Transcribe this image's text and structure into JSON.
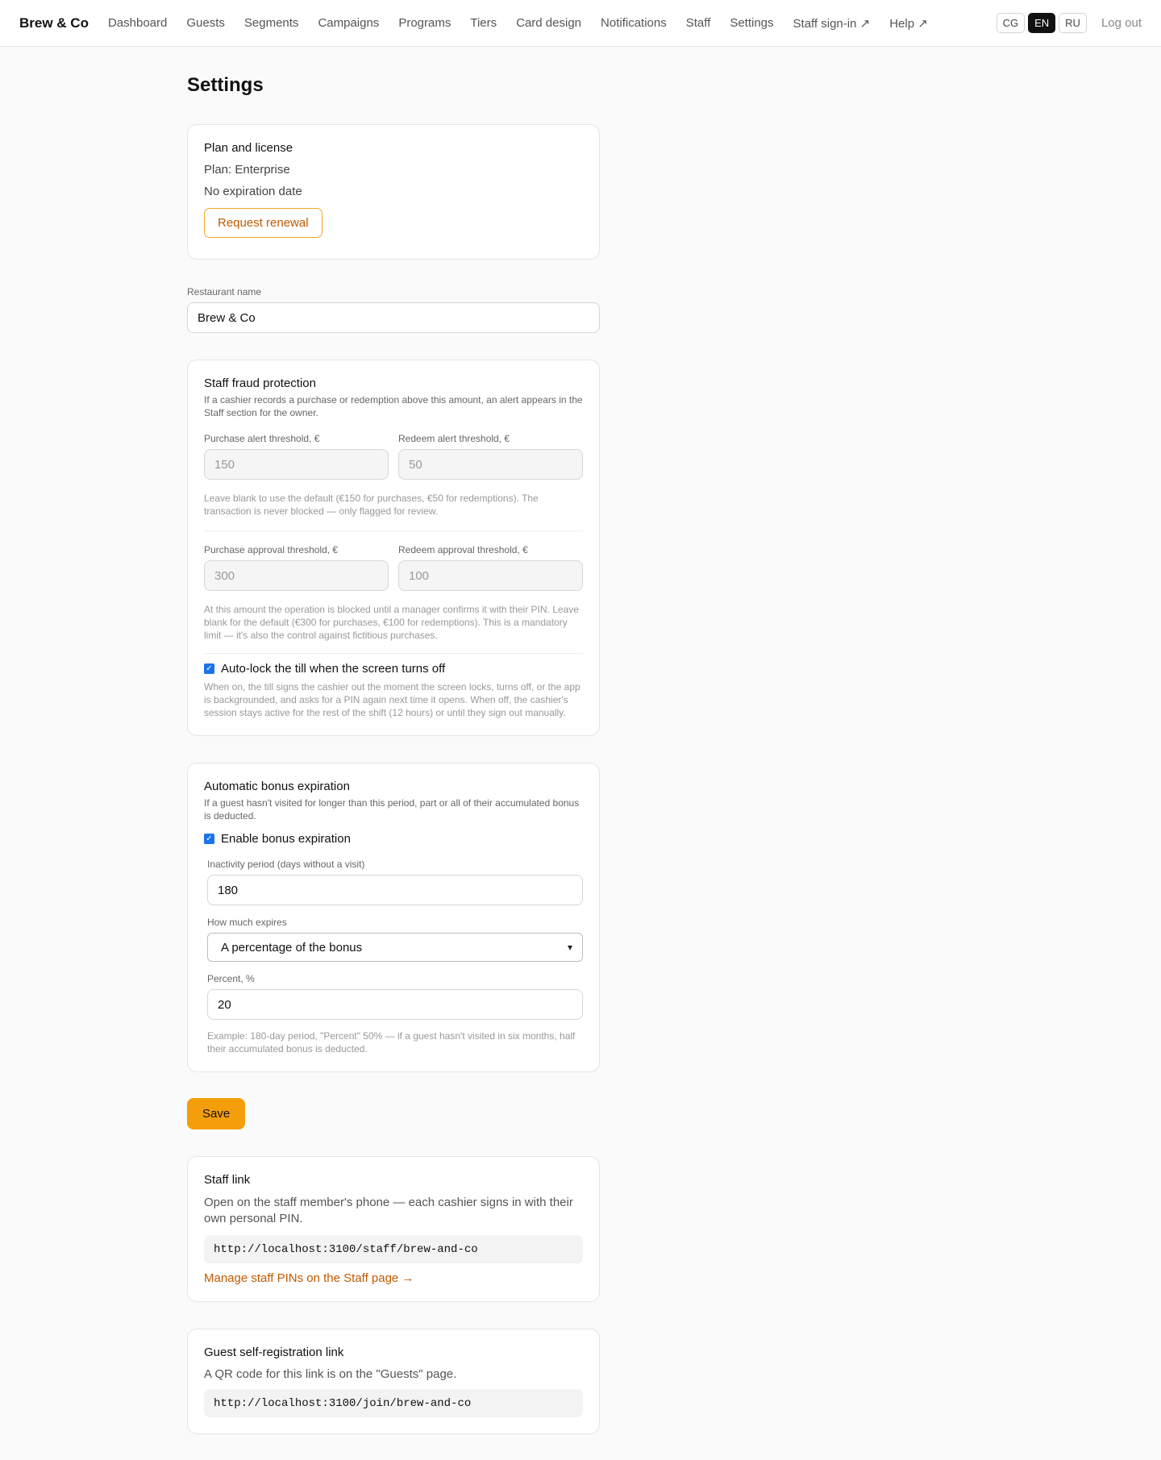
{
  "nav": {
    "brand": "Brew & Co",
    "links": [
      "Dashboard",
      "Guests",
      "Segments",
      "Campaigns",
      "Programs",
      "Tiers",
      "Card design",
      "Notifications",
      "Staff",
      "Settings",
      "Staff sign-in ↗",
      "Help ↗"
    ],
    "languages": [
      "CG",
      "EN",
      "RU"
    ],
    "active_language": "EN",
    "logout": "Log out"
  },
  "page": {
    "title": "Settings"
  },
  "plan": {
    "title": "Plan and license",
    "plan_line": "Plan: Enterprise",
    "expiration": "No expiration date",
    "renew_button": "Request renewal"
  },
  "restaurant": {
    "label": "Restaurant name",
    "value": "Brew & Co"
  },
  "fraud": {
    "title": "Staff fraud protection",
    "description": "If a cashier records a purchase or redemption above this amount, an alert appears in the Staff section for the owner.",
    "purchase_alert_label": "Purchase alert threshold, €",
    "purchase_alert_placeholder": "150",
    "redeem_alert_label": "Redeem alert threshold, €",
    "redeem_alert_placeholder": "50",
    "alert_hint": "Leave blank to use the default (€150 for purchases, €50 for redemptions). The transaction is never blocked — only flagged for review.",
    "purchase_approval_label": "Purchase approval threshold, €",
    "purchase_approval_placeholder": "300",
    "redeem_approval_label": "Redeem approval threshold, €",
    "redeem_approval_placeholder": "100",
    "approval_hint": "At this amount the operation is blocked until a manager confirms it with their PIN. Leave blank for the default (€300 for purchases, €100 for redemptions). This is a mandatory limit — it's also the control against fictitious purchases.",
    "autolock_label": "Auto-lock the till when the screen turns off",
    "autolock_checked": true,
    "autolock_hint": "When on, the till signs the cashier out the moment the screen locks, turns off, or the app is backgrounded, and asks for a PIN again next time it opens. When off, the cashier's session stays active for the rest of the shift (12 hours) or until they sign out manually."
  },
  "expiration": {
    "title": "Automatic bonus expiration",
    "description": "If a guest hasn't visited for longer than this period, part or all of their accumulated bonus is deducted.",
    "enable_label": "Enable bonus expiration",
    "enable_checked": true,
    "inactivity_label": "Inactivity period (days without a visit)",
    "inactivity_value": "180",
    "how_much_label": "How much expires",
    "how_much_value": "A percentage of the bonus",
    "percent_label": "Percent, %",
    "percent_value": "20",
    "example_hint": "Example: 180-day period, \"Percent\" 50% — if a guest hasn't visited in six months, half their accumulated bonus is deducted."
  },
  "save_button": "Save",
  "staff_link": {
    "title": "Staff link",
    "description": "Open on the staff member's phone — each cashier signs in with their own personal PIN.",
    "url": "http://localhost:3100/staff/brew-and-co",
    "manage_link": "Manage staff PINs on the Staff page →"
  },
  "guest_link": {
    "title": "Guest self-registration link",
    "description": "A QR code for this link is on the \"Guests\" page.",
    "url": "http://localhost:3100/join/brew-and-co"
  }
}
